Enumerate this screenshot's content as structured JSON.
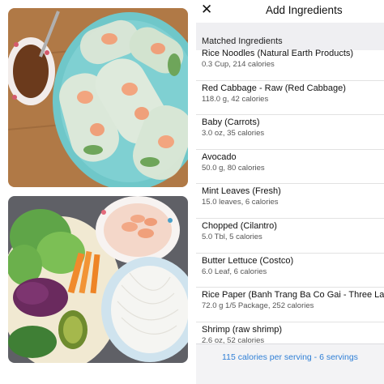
{
  "header": {
    "title": "Add Ingredients",
    "close_glyph": "✕"
  },
  "section": {
    "label": "Matched Ingredients"
  },
  "ingredients": [
    {
      "name": "Rice Noodles (Natural Earth Products)",
      "detail": "0.3 Cup, 214 calories"
    },
    {
      "name": "Red Cabbage - Raw (Red Cabbage)",
      "detail": "118.0 g, 42 calories"
    },
    {
      "name": "Baby (Carrots)",
      "detail": "3.0 oz, 35 calories"
    },
    {
      "name": "Avocado",
      "detail": "50.0 g, 80 calories"
    },
    {
      "name": "Mint Leaves (Fresh)",
      "detail": "15.0 leaves, 6 calories"
    },
    {
      "name": "Chopped (Cilantro)",
      "detail": "5.0 Tbl, 5 calories"
    },
    {
      "name": "Butter Lettuce (Costco)",
      "detail": "6.0 Leaf, 6 calories"
    },
    {
      "name": "Rice Paper (Banh Trang Ba Co Gai - Three Ladies)",
      "detail": "72.0 g 1/5 Package, 252 calories"
    },
    {
      "name": "Shrimp (raw shrimp)",
      "detail": "2.6 oz, 52 calories"
    }
  ],
  "footer": {
    "summary": "115 calories per serving - 6 servings"
  },
  "photos": {
    "top": "spring-rolls-plate-photo",
    "bottom": "ingredients-prep-photo"
  },
  "colors": {
    "accent": "#2f7fd6",
    "section_bg": "#efeff2",
    "plate_teal": "#6fc7c9"
  }
}
